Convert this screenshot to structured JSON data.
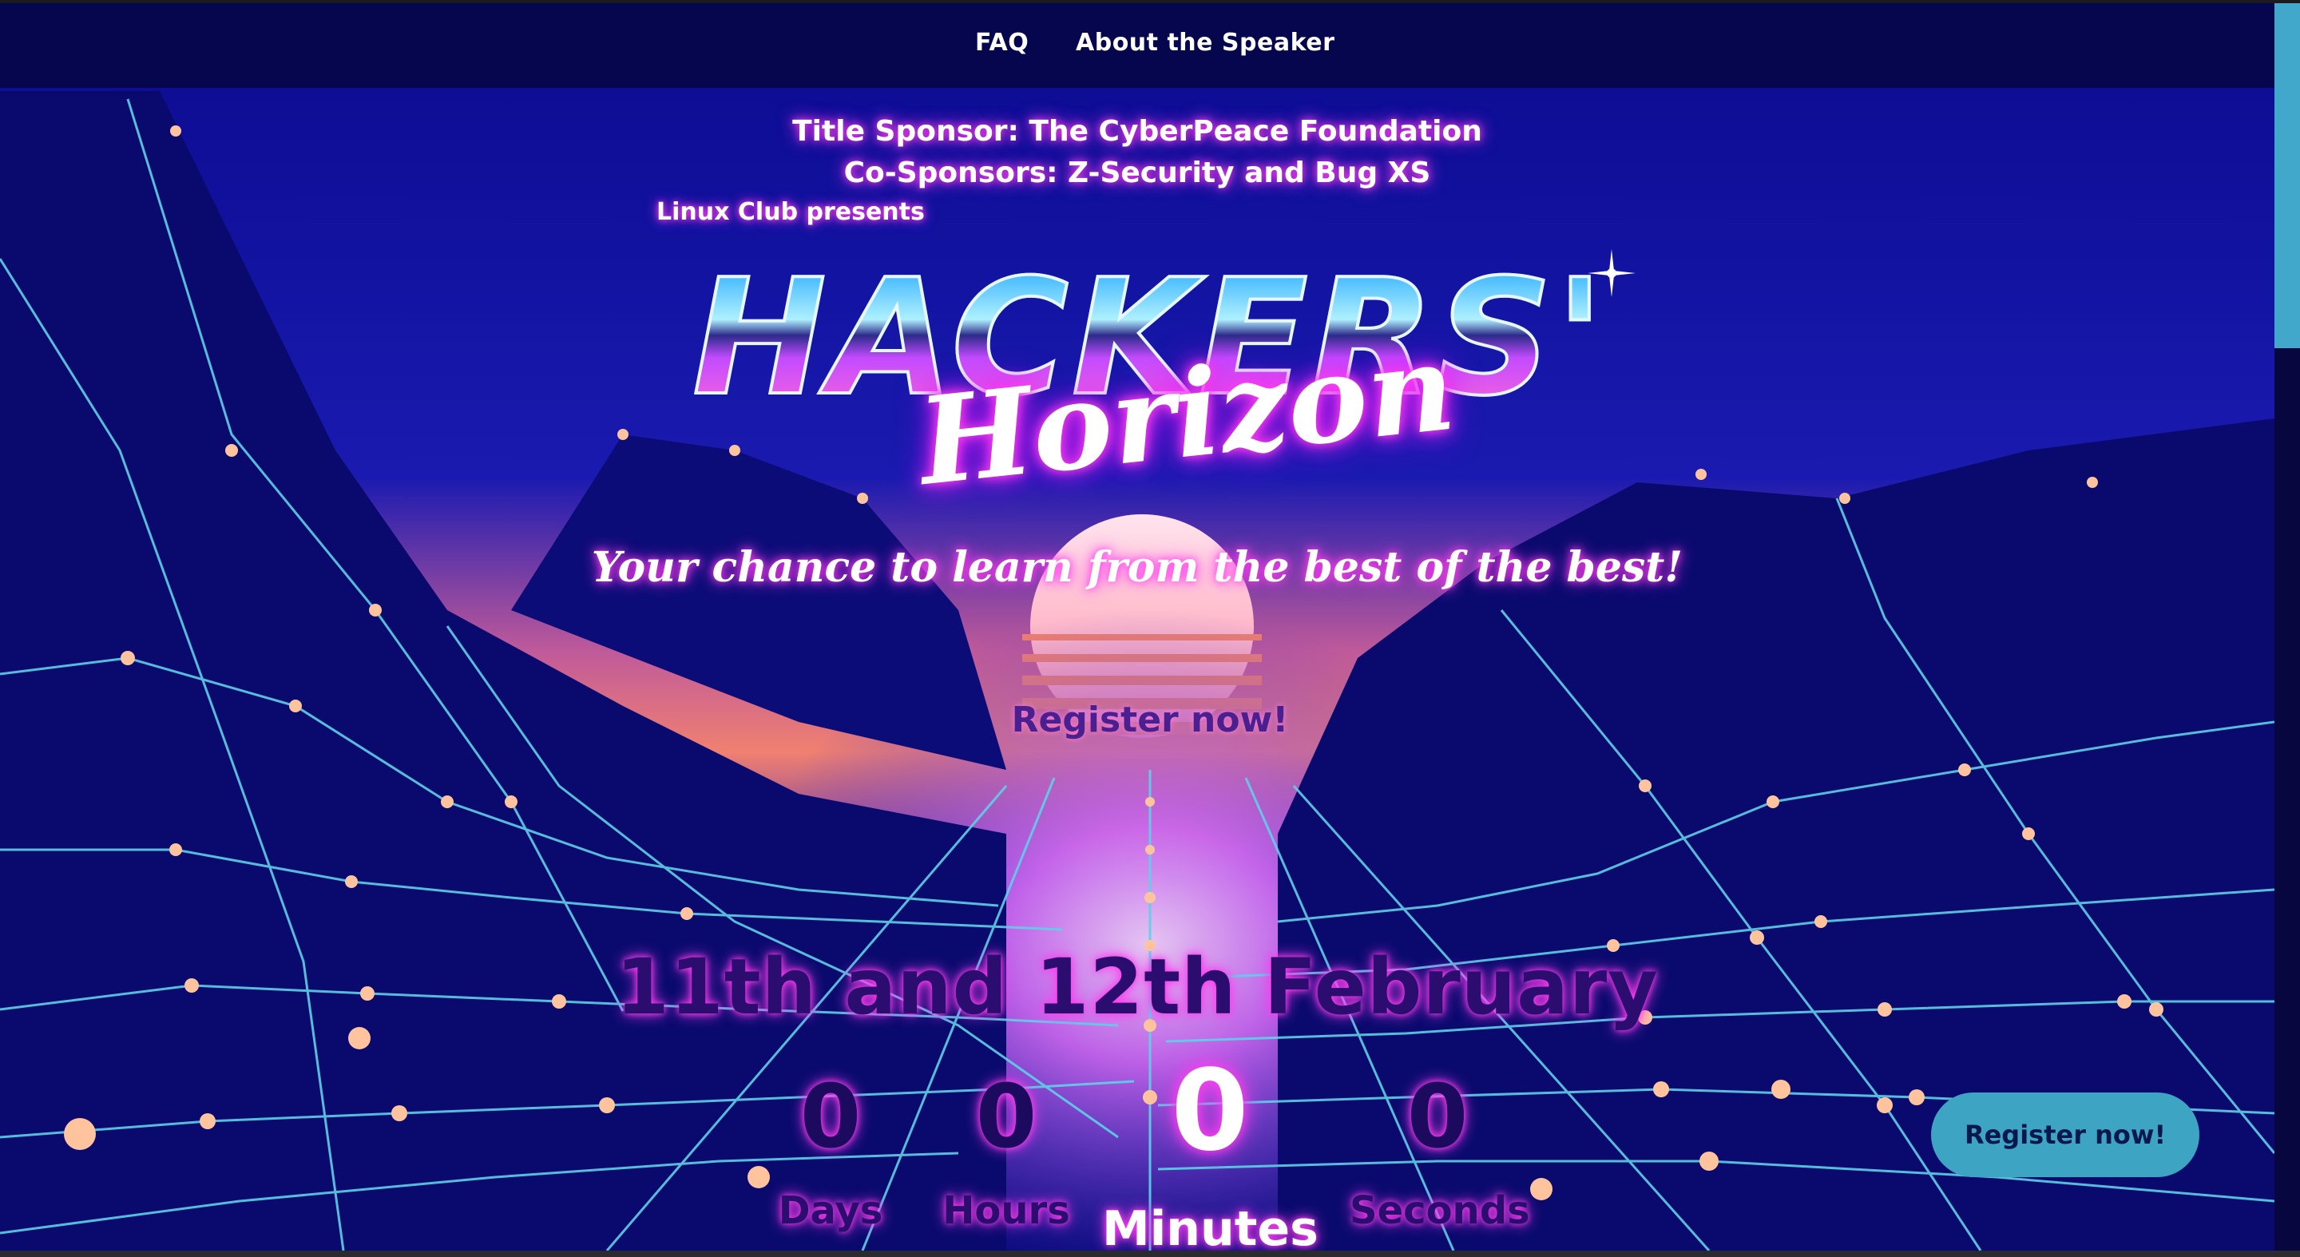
{
  "nav": {
    "items": [
      {
        "label": "FAQ"
      },
      {
        "label": "About the Speaker"
      }
    ]
  },
  "hero": {
    "title_sponsor": "Title Sponsor: The CyberPeace Foundation",
    "co_sponsors": "Co-Sponsors: Z-Security and Bug XS",
    "presents": "Linux Club presents",
    "logo_main": "HACKERS'",
    "logo_script": "Horizon",
    "tagline": "Your chance to learn from the best of the best!",
    "register_center_label": "Register now!",
    "event_dates": "11th and 12th February"
  },
  "countdown": {
    "days": {
      "value": "0",
      "label": "Days"
    },
    "hours": {
      "value": "0",
      "label": "Hours"
    },
    "minutes": {
      "value": "0",
      "label": "Minutes"
    },
    "seconds": {
      "value": "0",
      "label": "Seconds"
    }
  },
  "floating_button": {
    "label": "Register now!"
  },
  "colors": {
    "nav_background": "#05064d",
    "grid_line": "#5fd0e8",
    "grid_node": "#ffc49e",
    "neon_pink": "#ff3cf0",
    "button_background": "#3ea4c4",
    "scrollbar_thumb": "#41a8cc"
  }
}
